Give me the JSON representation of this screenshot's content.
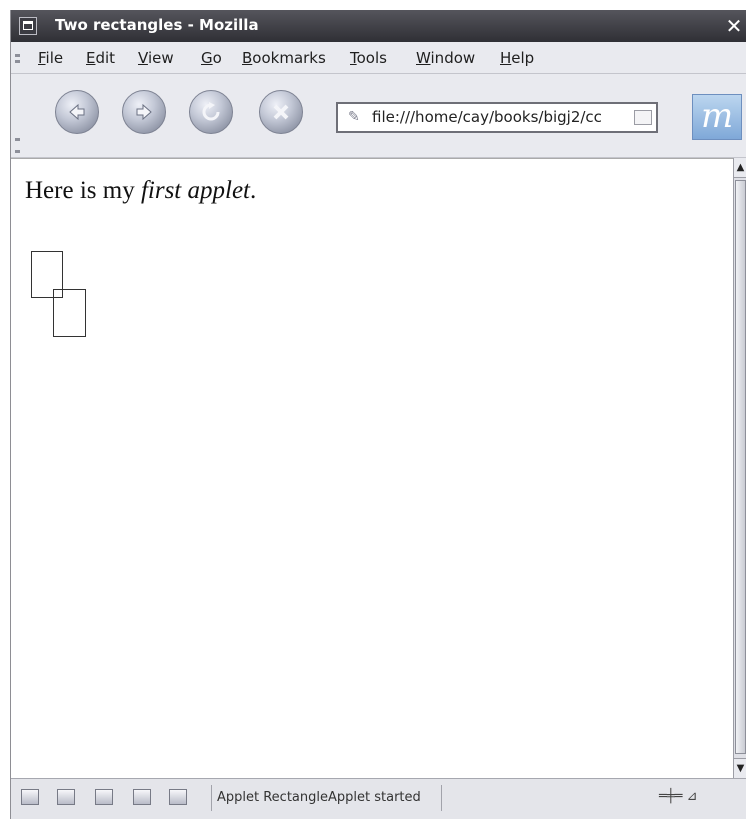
{
  "window": {
    "title": "Two rectangles - Mozilla",
    "close_glyph": "✕"
  },
  "menu": {
    "items": [
      "File",
      "Edit",
      "View",
      "Go",
      "Bookmarks",
      "Tools",
      "Window",
      "Help"
    ]
  },
  "toolbar": {
    "back_icon": "back-arrow-icon",
    "forward_icon": "forward-arrow-icon",
    "reload_icon": "reload-icon",
    "stop_icon": "stop-icon",
    "url": "file:///home/cay/books/bigj2/cc",
    "throbber_glyph": "m"
  },
  "content": {
    "heading_prefix": "Here is my ",
    "heading_emphasis": "first applet",
    "heading_suffix": "."
  },
  "statusbar": {
    "text": "Applet RectangleApplet started",
    "right_glyphs": "═╪═ ⊿"
  },
  "colors": {
    "titlebar": "#3a3a40",
    "chrome": "#e9eaef",
    "content_bg": "#ffffff"
  }
}
